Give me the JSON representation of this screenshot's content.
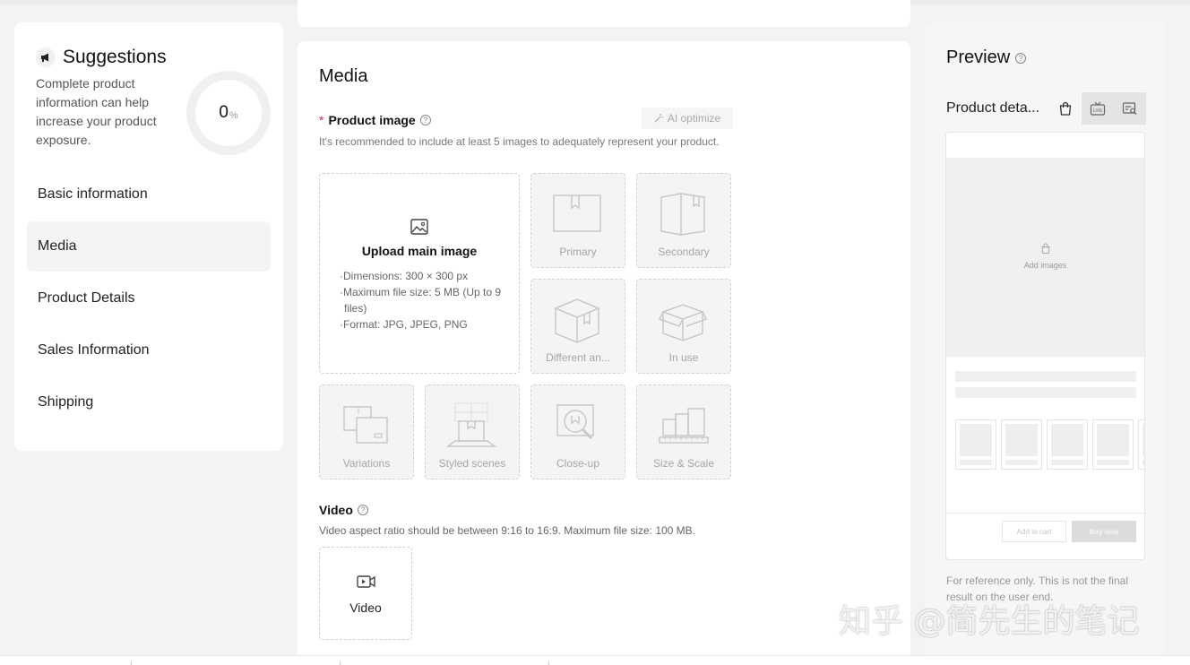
{
  "suggestions": {
    "title": "Suggestions",
    "description": "Complete product information can help increase your product exposure.",
    "score_value": "0",
    "score_unit": "%",
    "score_fraction": 0
  },
  "nav": [
    {
      "label": "Basic information",
      "active": false
    },
    {
      "label": "Media",
      "active": true
    },
    {
      "label": "Product Details",
      "active": false
    },
    {
      "label": "Sales Information",
      "active": false
    },
    {
      "label": "Shipping",
      "active": false
    }
  ],
  "media": {
    "title": "Media",
    "product_image": {
      "required_mark": "*",
      "label": "Product image",
      "ai_button": "AI optimize",
      "description": "It's recommended to include at least 5 images to adequately represent your product.",
      "upload_title": "Upload main image",
      "specs": [
        "·Dimensions: 300 × 300 px",
        "·Maximum file size: 5 MB (Up to 9 files)",
        "·Format: JPG, JPEG, PNG"
      ],
      "slots": [
        "Primary",
        "Secondary",
        "Different an...",
        "In use",
        "Variations",
        "Styled scenes",
        "Close-up",
        "Size & Scale"
      ]
    },
    "video": {
      "label": "Video",
      "description": "Video aspect ratio should be between 9:16 to 16:9. Maximum file size: 100 MB.",
      "slot_label": "Video"
    }
  },
  "preview": {
    "title": "Preview",
    "tab_label": "Product deta...",
    "add_images": "Add images",
    "add_to_cart": "Add to cart",
    "buy_now": "Buy now",
    "note": "For reference only. This is not the final result on the user end."
  },
  "watermark": "知乎 @简先生的笔记"
}
